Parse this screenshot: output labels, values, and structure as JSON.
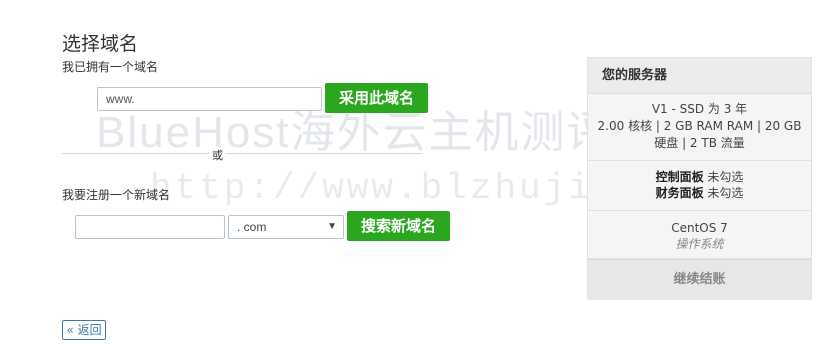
{
  "page": {
    "title": "选择域名"
  },
  "watermark": {
    "line1": "BlueHost海外云主机测评",
    "line2": "http://www.blzhuji.com/"
  },
  "existing_domain": {
    "label": "我已拥有一个域名",
    "input_value": "www.",
    "button_label": "采用此域名"
  },
  "divider": {
    "text": "或"
  },
  "new_domain": {
    "label": "我要注册一个新域名",
    "input_value": "",
    "tld_selected": ". com",
    "button_label": "搜索新域名"
  },
  "back": {
    "label": "« 返回"
  },
  "sidebar": {
    "header": "您的服务器",
    "spec_line1": "V1 - SSD 为 3 年",
    "spec_line2": "2.00 核核 | 2 GB RAM RAM | 20 GB",
    "spec_line3": "硬盘 | 2 TB 流量",
    "control_panel_key": "控制面板",
    "control_panel_value": "未勾选",
    "finance_panel_key": "财务面板",
    "finance_panel_value": "未勾选",
    "os_name": "CentOS 7",
    "os_label": "操作系统",
    "checkout_label": "继续结账"
  },
  "colors": {
    "accent_green": "#2ba61f",
    "link_blue": "#3b7bb0"
  }
}
